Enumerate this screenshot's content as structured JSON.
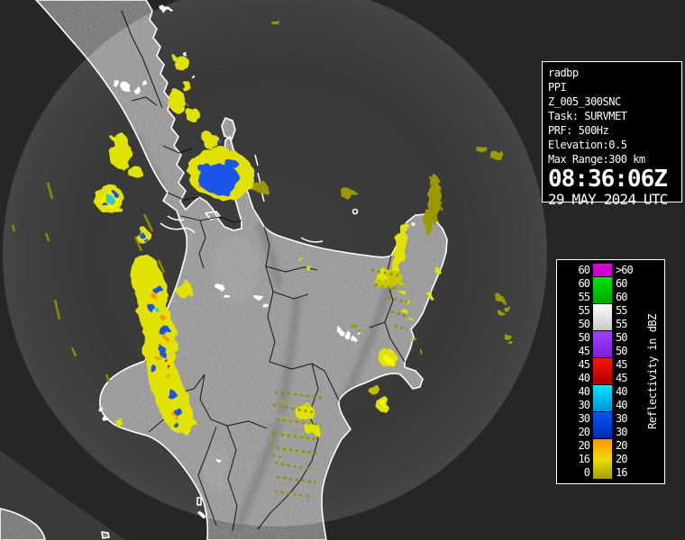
{
  "info_panel": {
    "lines": [
      "radbp",
      "PPI",
      "Z_005_300SNC",
      "Task: SURVMET",
      "PRF: 500Hz",
      "Elevation:0.5",
      "Max Range:300 km"
    ],
    "time": "08:36:06Z",
    "date": "29 MAY 2024 UTC"
  },
  "legend": {
    "axis_label": "Reflectivity in dBZ",
    "rows": [
      {
        "left": "60",
        "right": ">60"
      },
      {
        "left": "60",
        "right": "60"
      },
      {
        "left": "55",
        "right": "60"
      },
      {
        "left": "55",
        "right": "55"
      },
      {
        "left": "50",
        "right": "55"
      },
      {
        "left": "50",
        "right": "50"
      },
      {
        "left": "45",
        "right": "50"
      },
      {
        "left": "45",
        "right": "45"
      },
      {
        "left": "40",
        "right": "45"
      },
      {
        "left": "40",
        "right": "40"
      },
      {
        "left": "30",
        "right": "40"
      },
      {
        "left": "30",
        "right": "30"
      },
      {
        "left": "20",
        "right": "30"
      },
      {
        "left": "20",
        "right": "20"
      },
      {
        "left": "16",
        "right": "20"
      },
      {
        "left": "0",
        "right": "16"
      }
    ],
    "blocks": [
      {
        "rows": 1,
        "stops": [
          "#d800d8",
          "#c400c4"
        ],
        "name": "magenta-gt60"
      },
      {
        "rows": 2,
        "stops": [
          "#00e400",
          "#00a800"
        ],
        "name": "green-55-60"
      },
      {
        "rows": 2,
        "stops": [
          "#ffffff",
          "#c8c8c8"
        ],
        "name": "white-50-55"
      },
      {
        "rows": 2,
        "stops": [
          "#a040ff",
          "#7820d8"
        ],
        "name": "purple-45-50"
      },
      {
        "rows": 2,
        "stops": [
          "#ff1400",
          "#a80000"
        ],
        "name": "red-40-45"
      },
      {
        "rows": 2,
        "stops": [
          "#00e8ff",
          "#0090d8"
        ],
        "name": "cyan-30-40"
      },
      {
        "rows": 2,
        "stops": [
          "#0058f8",
          "#0028b0"
        ],
        "name": "blue-20-30"
      },
      {
        "rows": 3,
        "stops": [
          "#ff9400",
          "#f0dc00",
          "#a0a000"
        ],
        "name": "orange-yellow-0-20"
      }
    ]
  },
  "map_colors": {
    "background": "#262626",
    "sea_in_range": "#3b3b3b",
    "land_in_range": "#969696",
    "land_out_of_range": "#6e6e6e",
    "coastline": "#ffffff",
    "region_boundaries": "#000000",
    "echo_light": "#e2e200",
    "echo_light_over_sea": "#9a9a00",
    "echo_orange": "#ff9800",
    "echo_blue": "#1b55ec",
    "echo_cyan": "#00d8f0",
    "echo_red": "#e01010"
  }
}
